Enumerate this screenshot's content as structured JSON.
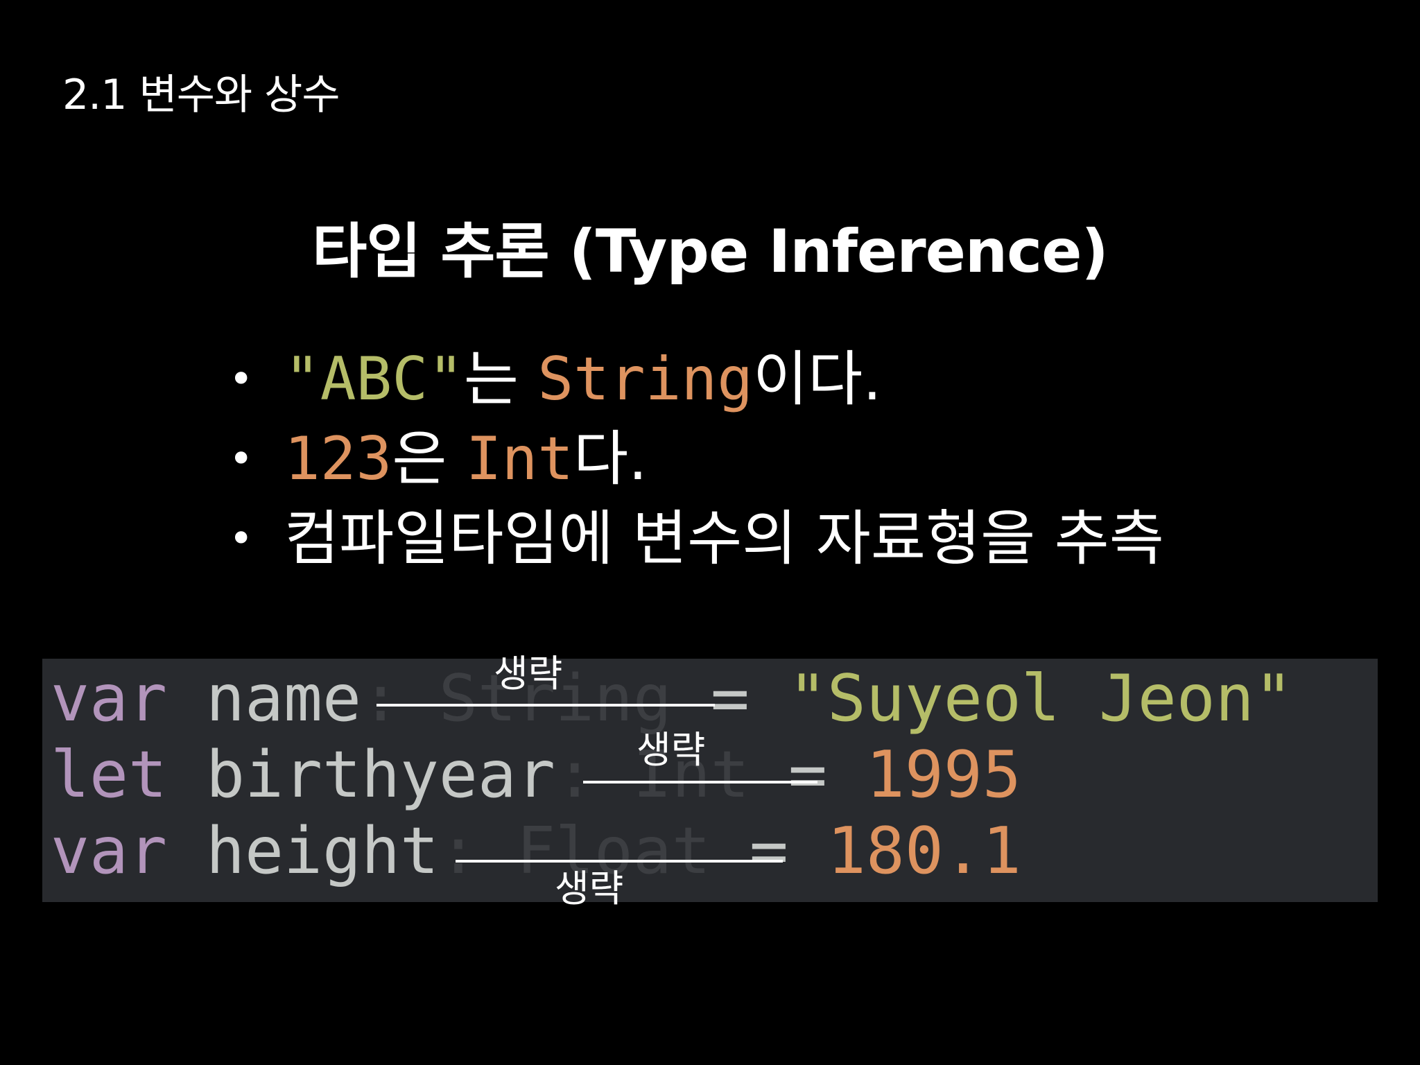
{
  "section_title": "2.1 변수와 상수",
  "slide_title": "타입 추론 (Type Inference)",
  "bullets": {
    "b1": {
      "dot": "•",
      "literal": "\"ABC\"",
      "text1": "는 ",
      "type": "String",
      "text2": "이다."
    },
    "b2": {
      "dot": "•",
      "literal": "123",
      "text1": "은 ",
      "type": "Int",
      "text2": "다."
    },
    "b3": {
      "dot": "•",
      "text": "컴파일타임에 변수의 자료형을 추측"
    }
  },
  "code": {
    "line1": {
      "keyword": "var",
      "name": "name",
      "annotation": ": String",
      "equals": "=",
      "value": "\"Suyeol Jeon\""
    },
    "line2": {
      "keyword": "let",
      "name": "birthyear",
      "annotation": ": Int",
      "equals": "=",
      "value": "1995"
    },
    "line3": {
      "keyword": "var",
      "name": "height",
      "annotation": ": Float",
      "equals": "=",
      "value": "180.1"
    }
  },
  "omit_label": "생략",
  "colors": {
    "background": "#000000",
    "code_background": "#282a2e",
    "keyword": "#b294bb",
    "identifier": "#c5c8c6",
    "string": "#b5bd68",
    "number_type": "#de935f",
    "text": "#ffffff"
  }
}
